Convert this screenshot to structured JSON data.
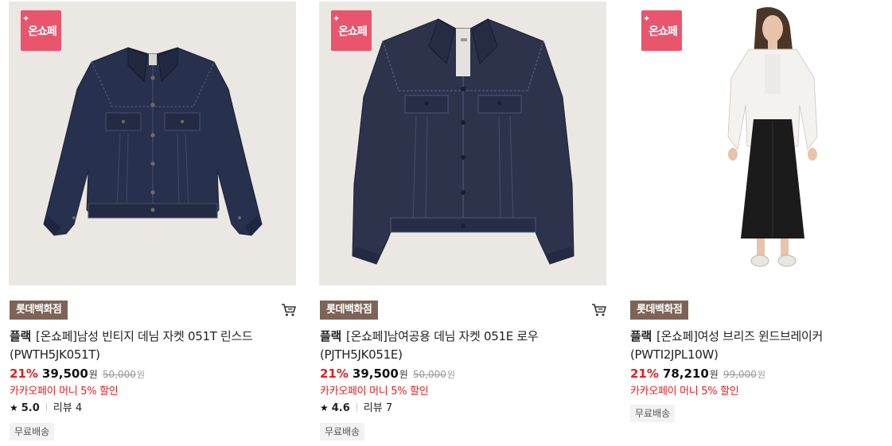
{
  "products": [
    {
      "badge": "온쇼페",
      "store": "롯데백화점",
      "brand": "플랙",
      "name": "[온쇼페]남성 빈티지 데님 자켓 051T 린스드 (PWTH5JK051T)",
      "discount": "21%",
      "price": "39,500",
      "currency": "원",
      "original_price": "50,000",
      "original_currency": "원",
      "promo": "카카오페이 머니 5% 할인",
      "rating": "5.0",
      "reviews": "리뷰 4",
      "shipping": "무료배송"
    },
    {
      "badge": "온쇼페",
      "store": "롯데백화점",
      "brand": "플랙",
      "name": "[온쇼페]남여공용 데님 자켓 051E 로우 (PJTH5JK051E)",
      "discount": "21%",
      "price": "39,500",
      "currency": "원",
      "original_price": "50,000",
      "original_currency": "원",
      "promo": "카카오페이 머니 5% 할인",
      "rating": "4.6",
      "reviews": "리뷰 7",
      "shipping": "무료배송"
    },
    {
      "badge": "온쇼페",
      "store": "롯데백화점",
      "brand": "플랙",
      "name": "[온쇼페]여성 브리즈 윈드브레이커 (PWTI2JPL10W)",
      "discount": "21%",
      "price": "78,210",
      "currency": "원",
      "original_price": "99,000",
      "original_currency": "원",
      "promo": "카카오페이 머니 5% 할인",
      "shipping": "무료배송"
    }
  ],
  "icons": {
    "badge_sparkle": "sparkle-icon",
    "cart": "cart-icon",
    "rating": "star-icon"
  },
  "colors": {
    "badge": "#e8556c",
    "store_tag": "#7d6457",
    "discount": "#e02020",
    "image_bg": "#ebe7e3",
    "shipping_tag": "#f2f2f2"
  }
}
